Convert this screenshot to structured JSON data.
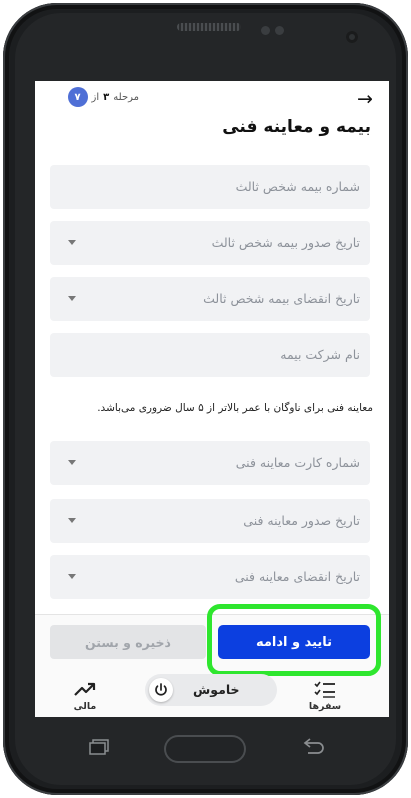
{
  "header": {
    "step_word": "مرحله",
    "step_current": "۳",
    "step_of": "از",
    "step_total": "۷",
    "title": "بیمه و معاینه فنی"
  },
  "fields": [
    {
      "label": "شماره بیمه شخص ثالث",
      "dropdown": false
    },
    {
      "label": "تاریخ صدور بیمه شخص ثالث",
      "dropdown": true
    },
    {
      "label": "تاریخ انقضای بیمه شخص ثالث",
      "dropdown": true
    },
    {
      "label": "نام شرکت بیمه",
      "dropdown": false
    },
    {
      "label": "شماره کارت معاینه فنی",
      "dropdown": true
    },
    {
      "label": "تاریخ صدور معاینه فنی",
      "dropdown": true
    },
    {
      "label": "تاریخ انقضای معاینه فنی",
      "dropdown": true
    }
  ],
  "note": "معاینه فنی برای ناوگان با عمر بالاتر از ۵ سال ضروری می‌باشد.",
  "buttons": {
    "confirm": "تایید و ادامه",
    "save": "ذخیره و بستن"
  },
  "nav": {
    "trips": "سفرها",
    "financial": "مالی",
    "power_status": "خاموش"
  },
  "colors": {
    "primary": "#0c3fe0",
    "step_badge": "#4f6fd6",
    "highlight": "#2ee62e"
  }
}
